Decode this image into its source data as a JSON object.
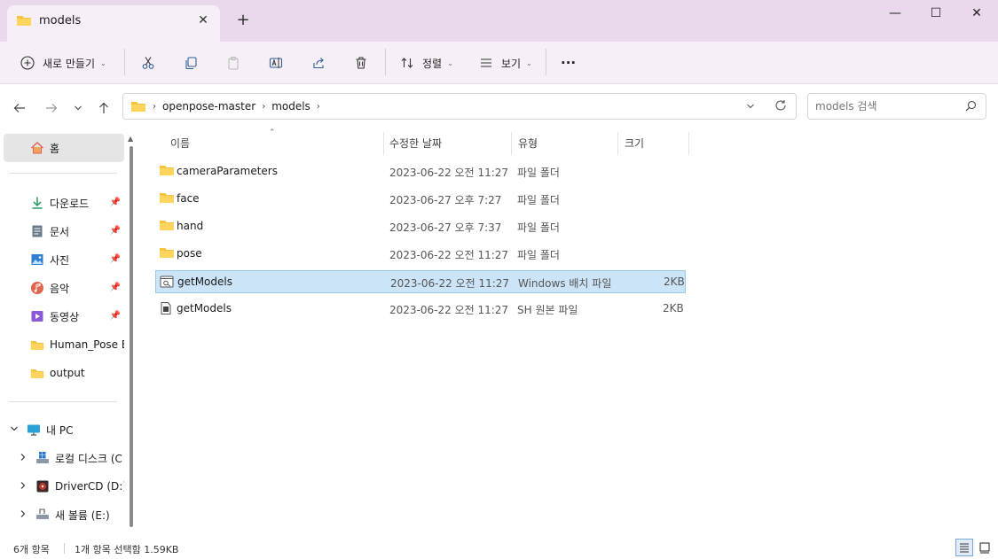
{
  "window": {
    "tab_title": "models",
    "new_tab": "+",
    "close_tab": "✕",
    "minimize": "—",
    "maximize": "☐",
    "close": "✕"
  },
  "toolbar": {
    "new_label": "새로 만들기",
    "sort_label": "정렬",
    "view_label": "보기",
    "more_label": "···"
  },
  "address": {
    "crumbs": [
      "openpose-master",
      "models"
    ]
  },
  "search": {
    "placeholder": "models 검색"
  },
  "sidebar": {
    "home": "홈",
    "quick": [
      {
        "label": "다운로드",
        "icon": "download-icon",
        "color": "#1f9b5e"
      },
      {
        "label": "문서",
        "icon": "document-icon",
        "color": "#6a7a8c"
      },
      {
        "label": "사진",
        "icon": "picture-icon",
        "color": "#2d7fd3"
      },
      {
        "label": "음악",
        "icon": "music-icon",
        "color": "#e0644e"
      },
      {
        "label": "동영상",
        "icon": "video-icon",
        "color": "#8b5ad6"
      }
    ],
    "folders": [
      "Human_Pose Es",
      "output"
    ],
    "this_pc": "내 PC",
    "drives": [
      {
        "label": "로컬 디스크 (C",
        "icon": "windows-drive-icon"
      },
      {
        "label": "DriverCD (D:)",
        "icon": "cd-drive-icon"
      },
      {
        "label": "새 볼륨 (E:)",
        "icon": "usb-drive-icon"
      }
    ]
  },
  "columns": {
    "name": "이름",
    "date": "수정한 날짜",
    "type": "유형",
    "size": "크기"
  },
  "files": [
    {
      "name": "cameraParameters",
      "date": "2023-06-22 오전 11:27",
      "type": "파일 폴더",
      "size": "",
      "icon": "folder-icon"
    },
    {
      "name": "face",
      "date": "2023-06-27 오후 7:27",
      "type": "파일 폴더",
      "size": "",
      "icon": "folder-icon"
    },
    {
      "name": "hand",
      "date": "2023-06-27 오후 7:37",
      "type": "파일 폴더",
      "size": "",
      "icon": "folder-icon"
    },
    {
      "name": "pose",
      "date": "2023-06-22 오전 11:27",
      "type": "파일 폴더",
      "size": "",
      "icon": "folder-icon"
    },
    {
      "name": "getModels",
      "date": "2023-06-22 오전 11:27",
      "type": "Windows 배치 파일",
      "size": "2KB",
      "icon": "batch-file-icon",
      "selected": true
    },
    {
      "name": "getModels",
      "date": "2023-06-22 오전 11:27",
      "type": "SH 원본 파일",
      "size": "2KB",
      "icon": "script-file-icon"
    }
  ],
  "status": {
    "count": "6개 항목",
    "selection": "1개 항목 선택함 1.59KB"
  },
  "colors": {
    "titlebar": "#ead9ec",
    "toolbar": "#f6eff7",
    "folder": "#f5c242",
    "selection": "#cce4f7"
  }
}
